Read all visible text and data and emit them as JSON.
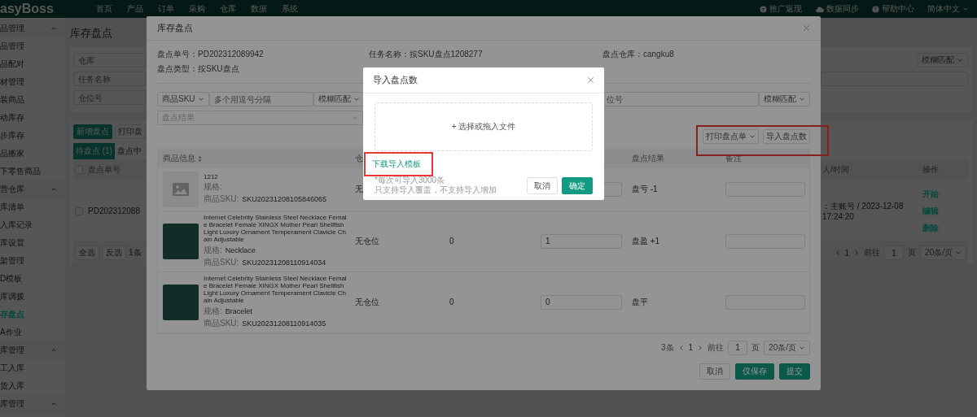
{
  "nav": {
    "logo": "asyBoss",
    "menu": [
      "首页",
      "产品",
      "订单",
      "采购",
      "仓库",
      "数据",
      "系统"
    ],
    "links": [
      "推广返现",
      "数据同步",
      "帮助中心"
    ],
    "language": "简体中文"
  },
  "sidebar": {
    "groups": [
      {
        "title": "品管理",
        "expanded": true,
        "items": [
          {
            "label": "品管理",
            "selected": false
          },
          {
            "label": "品配对",
            "selected": false
          },
          {
            "label": "材管理",
            "selected": false
          },
          {
            "label": "装商品",
            "selected": false
          },
          {
            "label": "动库存",
            "selected": false
          },
          {
            "label": "步库存",
            "selected": false
          },
          {
            "label": "品搬家",
            "selected": false
          },
          {
            "label": "下零售商品",
            "selected": false
          }
        ]
      },
      {
        "title": "营仓库",
        "expanded": true,
        "items": [
          {
            "label": "库清单",
            "selected": false
          },
          {
            "label": "入库记录",
            "selected": false
          },
          {
            "label": "库设置",
            "selected": false
          },
          {
            "label": "架管理",
            "selected": false
          },
          {
            "label": "D模板",
            "selected": false
          },
          {
            "label": "库调拨",
            "selected": false
          },
          {
            "label": "存盘点",
            "selected": true
          },
          {
            "label": "A作业",
            "selected": false
          }
        ]
      },
      {
        "title": "库管理",
        "expanded": true,
        "items": [
          {
            "label": "工入库",
            "selected": false
          },
          {
            "label": "货入库",
            "selected": false
          }
        ]
      },
      {
        "title": "库管理",
        "expanded": true
      }
    ]
  },
  "page": {
    "title": "库存盘点",
    "filters": [
      {
        "placeholder": "仓库"
      },
      {
        "placeholder": "任务名称"
      },
      {
        "placeholder": "仓位号"
      }
    ],
    "match_select": "模糊匹配",
    "buttons": [
      {
        "label": "新增盘点",
        "kind": "primary"
      },
      {
        "label": "打印盘",
        "kind": "default"
      }
    ],
    "tabs": [
      {
        "label": "待盘点 (1)",
        "selected": true
      },
      {
        "label": "盘点中",
        "selected": false
      }
    ],
    "table": {
      "header_checked": false,
      "columns": {
        "number": "盘点单号",
        "created": "人/时间",
        "actions": "操作"
      },
      "row": {
        "checked": false,
        "number": "PD202312088",
        "created": "：主账号 / 2023-12-08 17:24:20",
        "actions": [
          "开始",
          "编辑",
          "删除"
        ]
      },
      "footer": {
        "buttons": [
          "全选",
          "反选"
        ],
        "count": "1条"
      },
      "pagination": {
        "page": "1",
        "goto_label": "前往",
        "goto_value": "1",
        "page_unit": "页",
        "page_size": "20条/页"
      }
    }
  },
  "count_dialog": {
    "title": "库存盘点",
    "info": [
      "盘点单号：PD202312089942",
      "任务名称：按SKU盘点1208277",
      "盘点仓库：cangku8",
      "盘点类型：按SKU盘点"
    ],
    "filters": {
      "field_select": "商品SKU",
      "field_placeholder": "多个用逗号分隔",
      "match": "模糊匹配",
      "location_placeholder": "位号",
      "location_match": "模糊匹配",
      "result_placeholder": "盘点结果"
    },
    "toolbar": {
      "highlighted": true,
      "print": "打印盘点单",
      "import": "导入盘点数"
    },
    "table": {
      "columns": {
        "product": "商品信息",
        "product_sortable": true,
        "location": "仓",
        "result": "盘点结果",
        "note": "备注"
      },
      "rows": [
        {
          "image": {
            "kind": "placeholder"
          },
          "name": "1212",
          "spec_label": "规格:",
          "sku_label": "商品SKU:",
          "sku": "SKU20231208105846065",
          "location": "无",
          "result": "盘亏 -1"
        },
        {
          "image": {
            "kind": "photo"
          },
          "name": "Internet Celebrity Stainless Steel Necklace Female Bracelet Female XINGX Mother Pearl Shellfish Light Luxury Ornament Temperament Clavicle Chain Adjustable",
          "spec_label": "规格:",
          "spec": "Necklace",
          "sku_label": "商品SKU:",
          "sku": "SKU20231208110914034",
          "location": "无仓位",
          "system_qty": "0",
          "count": "1",
          "result": "盘盈 +1"
        },
        {
          "image": {
            "kind": "photo"
          },
          "name": "Internet Celebrity Stainless Steel Necklace Female Bracelet Female XINGX Mother Pearl Shellfish Light Luxury Ornament Temperament Clavicle Chain Adjustable",
          "spec_label": "规格:",
          "spec": "Bracelet",
          "sku_label": "商品SKU:",
          "sku": "SKU20231208110914035",
          "location": "无仓位",
          "system_qty": "0",
          "count": "0",
          "result": "盘平"
        }
      ]
    },
    "pagination": {
      "total": "3条",
      "page": "1",
      "goto_label": "前往",
      "goto_value": "1",
      "page_unit": "页",
      "page_size": "20条/页"
    },
    "buttons": [
      {
        "label": "取消",
        "kind": "default"
      },
      {
        "label": "仅保存",
        "kind": "primary"
      },
      {
        "label": "提交",
        "kind": "primary"
      }
    ]
  },
  "import_dialog": {
    "title": "导入盘点数",
    "upload": "+ 选择或拖入文件",
    "template_link": {
      "label": "下载导入模板",
      "highlighted": true
    },
    "notes": [
      "*每次可导入3000条",
      "只支持导入覆盖，不支持导入增加"
    ],
    "buttons": [
      {
        "label": "取消",
        "kind": "default"
      },
      {
        "label": "确定",
        "kind": "primary"
      }
    ]
  }
}
